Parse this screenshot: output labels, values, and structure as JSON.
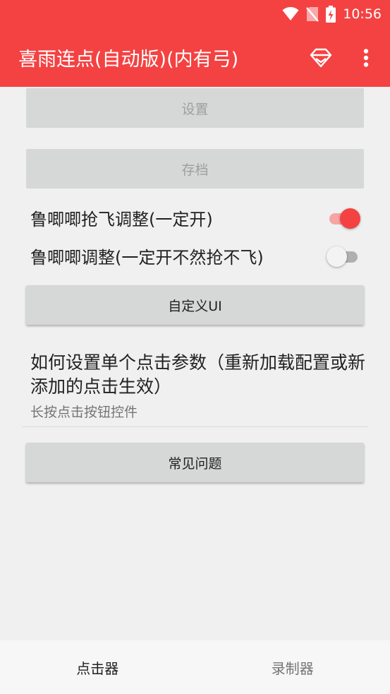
{
  "status_bar": {
    "time": "10:56",
    "icons": [
      "wifi-icon",
      "no-sim-icon",
      "battery-charging-icon"
    ]
  },
  "app_bar": {
    "title": "喜雨连点(自动版)(内有弓)",
    "actions": [
      "gem-icon",
      "more-vert-icon"
    ],
    "color": "#f44242"
  },
  "main": {
    "settings_button": "设置",
    "archive_button": "存档",
    "switches": [
      {
        "label": "鲁唧唧抢飞调整(一定开)",
        "on": true
      },
      {
        "label": "鲁唧唧调整(一定开不然抢不飞)",
        "on": false
      }
    ],
    "custom_ui_button": "自定义UI",
    "help_pref": {
      "title": "如何设置单个点击参数（重新加载配置或新添加的点击生效）",
      "summary": "长按点击按钮控件"
    },
    "faq_button": "常见问题"
  },
  "bottom_nav": {
    "tabs": [
      {
        "label": "点击器",
        "active": true
      },
      {
        "label": "录制器",
        "active": false
      }
    ]
  },
  "colors": {
    "accent": "#f44242",
    "button_bg": "#d6d7d7",
    "background": "#f0f0f0"
  }
}
